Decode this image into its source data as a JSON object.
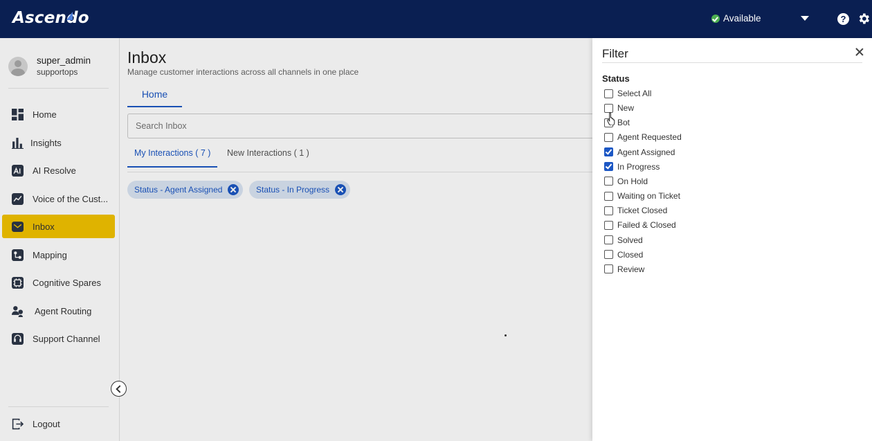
{
  "app": {
    "logo": "Ascendo"
  },
  "topbar": {
    "status_label": "Available",
    "help_glyph": "?"
  },
  "profile": {
    "name": "super_admin",
    "org": "supportops"
  },
  "nav": {
    "items": [
      {
        "label": "Home",
        "icon": "grid-icon"
      },
      {
        "label": "Insights",
        "icon": "bar-chart-icon"
      },
      {
        "label": "AI Resolve",
        "icon": "ai-resolve-icon"
      },
      {
        "label": "Voice of the Cust...",
        "icon": "voice-icon"
      },
      {
        "label": "Inbox",
        "icon": "mail-icon",
        "active": true
      },
      {
        "label": "Mapping",
        "icon": "mapping-icon"
      },
      {
        "label": "Cognitive Spares",
        "icon": "cognitive-spares-icon"
      },
      {
        "label": "Agent Routing",
        "icon": "agent-routing-icon"
      },
      {
        "label": "Support Channel",
        "icon": "support-channel-icon"
      }
    ],
    "logout_label": "Logout"
  },
  "main": {
    "title": "Inbox",
    "subtitle": "Manage customer interactions across all channels in one place",
    "tab_home": "Home",
    "search_placeholder": "Search Inbox",
    "subtabs": [
      "My Interactions ( 7 )",
      "New Interactions ( 1 )"
    ],
    "chips": [
      "Status - Agent Assigned",
      "Status - In Progress"
    ]
  },
  "filter": {
    "title": "Filter",
    "section": "Status",
    "options": [
      {
        "label": "Select All",
        "checked": false
      },
      {
        "label": "New",
        "checked": false
      },
      {
        "label": "Bot",
        "checked": false
      },
      {
        "label": "Agent Requested",
        "checked": false
      },
      {
        "label": "Agent Assigned",
        "checked": true
      },
      {
        "label": "In Progress",
        "checked": true
      },
      {
        "label": "On Hold",
        "checked": false
      },
      {
        "label": "Waiting on Ticket",
        "checked": false
      },
      {
        "label": "Ticket Closed",
        "checked": false
      },
      {
        "label": "Failed & Closed",
        "checked": false
      },
      {
        "label": "Solved",
        "checked": false
      },
      {
        "label": "Closed",
        "checked": false
      },
      {
        "label": "Review",
        "checked": false
      }
    ]
  },
  "colors": {
    "topbar": "#0a1f52",
    "accent": "#1c57c4",
    "active_nav": "#f2c300",
    "status_ok": "#4caf50"
  }
}
